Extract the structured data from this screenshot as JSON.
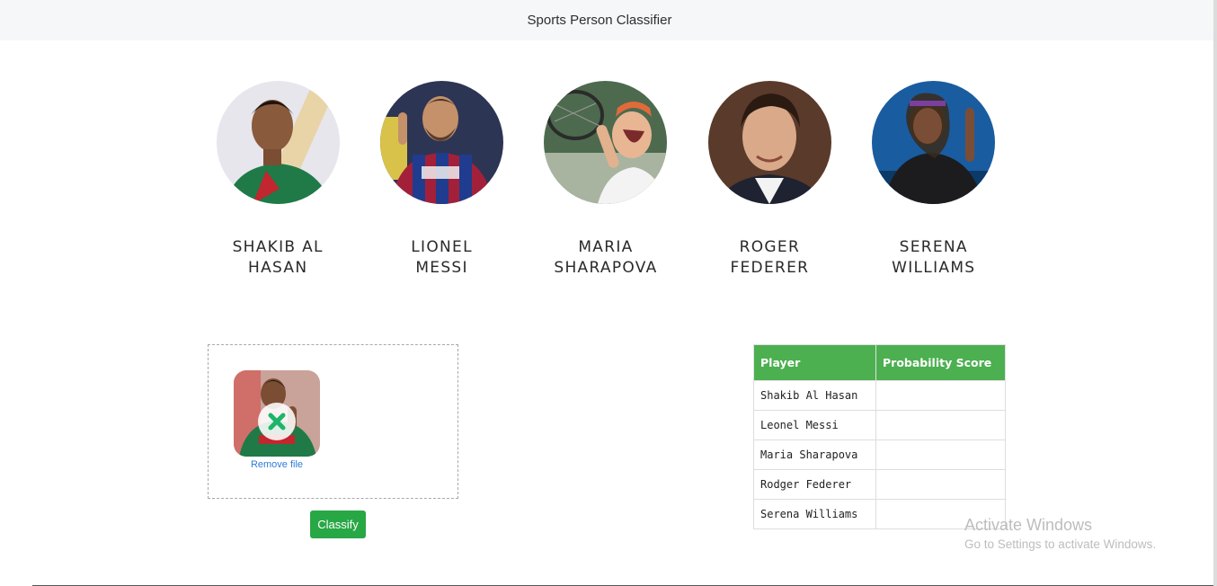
{
  "navbar": {
    "title": "Sports Person Classifier"
  },
  "players": [
    {
      "name": "SHAKIB AL HASAN",
      "line1": "SHAKIB AL",
      "line2": "HASAN",
      "photo_icon": "portrait-photo",
      "dominant_color": "#1d7a44"
    },
    {
      "name": "LIONEL MESSI",
      "line1": "LIONEL",
      "line2": "MESSI",
      "photo_icon": "portrait-photo",
      "dominant_color": "#2a3f9a"
    },
    {
      "name": "MARIA SHARAPOVA",
      "line1": "MARIA",
      "line2": "SHARAPOVA",
      "photo_icon": "portrait-photo",
      "dominant_color": "#c0704a"
    },
    {
      "name": "ROGER FEDERER",
      "line1": "ROGER",
      "line2": "FEDERER",
      "photo_icon": "portrait-photo",
      "dominant_color": "#3a2a22"
    },
    {
      "name": "SERENA WILLIAMS",
      "line1": "SERENA",
      "line2": "WILLIAMS",
      "photo_icon": "portrait-photo",
      "dominant_color": "#1b5e8c"
    }
  ],
  "dropzone": {
    "remove_label": "Remove file",
    "remove_icon": "close-x-icon"
  },
  "classify_button": {
    "label": "Classify"
  },
  "results_table": {
    "headers": [
      "Player",
      "Probability Score"
    ],
    "rows": [
      {
        "player": "Shakib Al Hasan",
        "score": ""
      },
      {
        "player": "Leonel Messi",
        "score": ""
      },
      {
        "player": "Maria Sharapova",
        "score": ""
      },
      {
        "player": "Rodger Federer",
        "score": ""
      },
      {
        "player": "Serena Williams",
        "score": ""
      }
    ]
  },
  "watermark": {
    "title": "Activate Windows",
    "subtitle": "Go to Settings to activate Windows."
  },
  "colors": {
    "accent_green": "#28a745",
    "table_header_green": "#4caf50",
    "link_blue": "#2f7bd6",
    "navbar_bg": "#f6f7f9"
  }
}
